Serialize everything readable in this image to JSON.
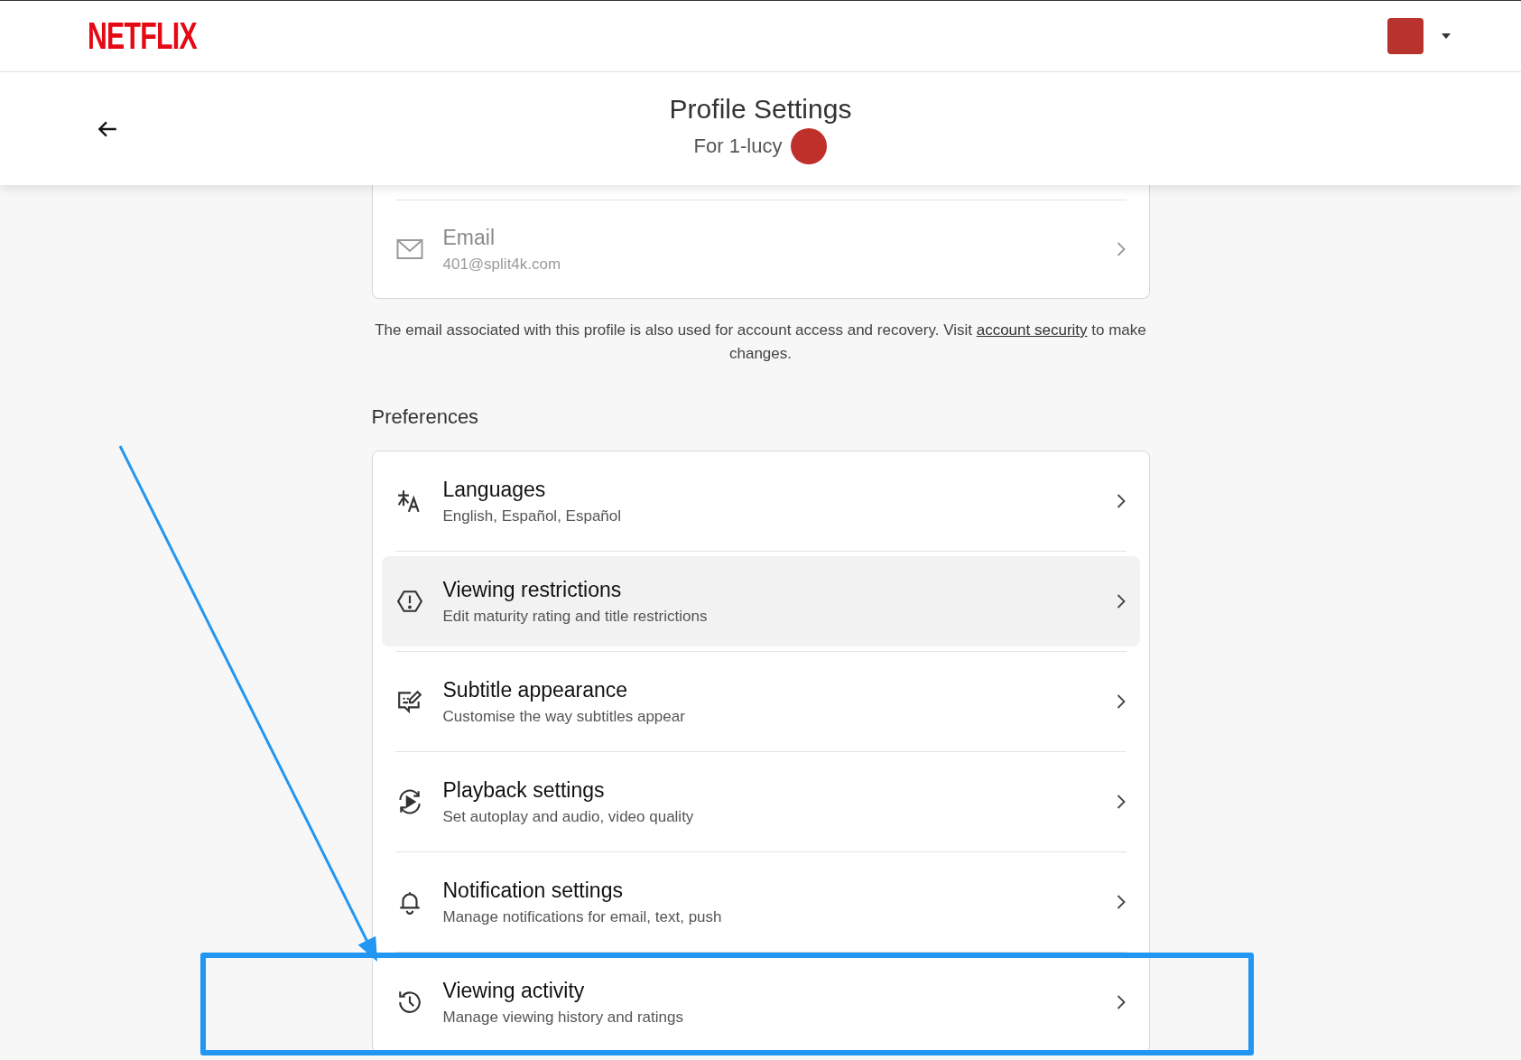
{
  "top_bar": {
    "logo": "NETFLIX"
  },
  "header": {
    "title": "Profile Settings",
    "subtitle": "For 1-lucy"
  },
  "email_row": {
    "label": "Email",
    "value": "401@split4k.com",
    "disabled": true
  },
  "email_note": {
    "before": "The email associated with this profile is also used for account access and recovery. Visit",
    "link": "account security",
    "after": "to make changes."
  },
  "preferences": {
    "heading": "Preferences",
    "items": [
      {
        "kind": "languages",
        "title": "Languages",
        "subtitle": "English, Español, Español",
        "hovered": false,
        "annotated": false
      },
      {
        "kind": "restrictions",
        "title": "Viewing restrictions",
        "subtitle": "Edit maturity rating and title restrictions",
        "hovered": true,
        "annotated": false
      },
      {
        "kind": "subtitles",
        "title": "Subtitle appearance",
        "subtitle": "Customise the way subtitles appear",
        "hovered": false,
        "annotated": false
      },
      {
        "kind": "playback",
        "title": "Playback settings",
        "subtitle": "Set autoplay and audio, video quality",
        "hovered": false,
        "annotated": false
      },
      {
        "kind": "notifications",
        "title": "Notification settings",
        "subtitle": "Manage notifications for email, text, push",
        "hovered": false,
        "annotated": false
      },
      {
        "kind": "activity",
        "title": "Viewing activity",
        "subtitle": "Manage viewing history and ratings",
        "hovered": false,
        "annotated": true
      }
    ]
  }
}
